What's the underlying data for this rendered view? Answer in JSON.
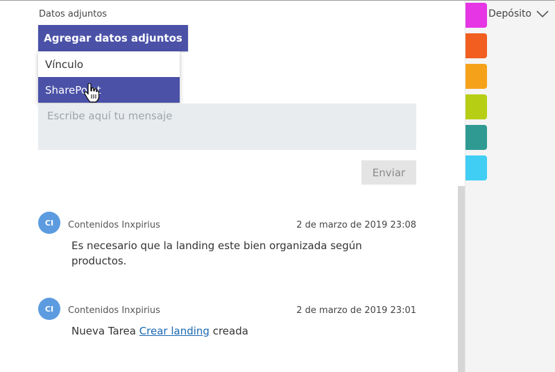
{
  "attachments": {
    "label": "Datos adjuntos",
    "add_button": "Agregar datos adjuntos",
    "menu": [
      "Vínculo",
      "SharePoint"
    ]
  },
  "composer": {
    "placeholder": "Escribe aquí tu mensaje",
    "send_label": "Enviar"
  },
  "comments": [
    {
      "initials": "CI",
      "author": "Contenidos Inxpirius",
      "timestamp": "2 de marzo de 2019 23:08",
      "text": "Es necesario que la landing este bien organizada según productos."
    },
    {
      "initials": "CI",
      "author": "Contenidos Inxpirius",
      "timestamp": "2 de marzo de 2019 23:01",
      "prefix": "Nueva Tarea ",
      "link": "Crear landing",
      "suffix": " creada"
    }
  ],
  "labels_panel": {
    "bucket": "Depósito",
    "colors": [
      "#e535e5",
      "#f15e20",
      "#f5a21a",
      "#b6cf14",
      "#2f9a92",
      "#40cef5"
    ]
  }
}
